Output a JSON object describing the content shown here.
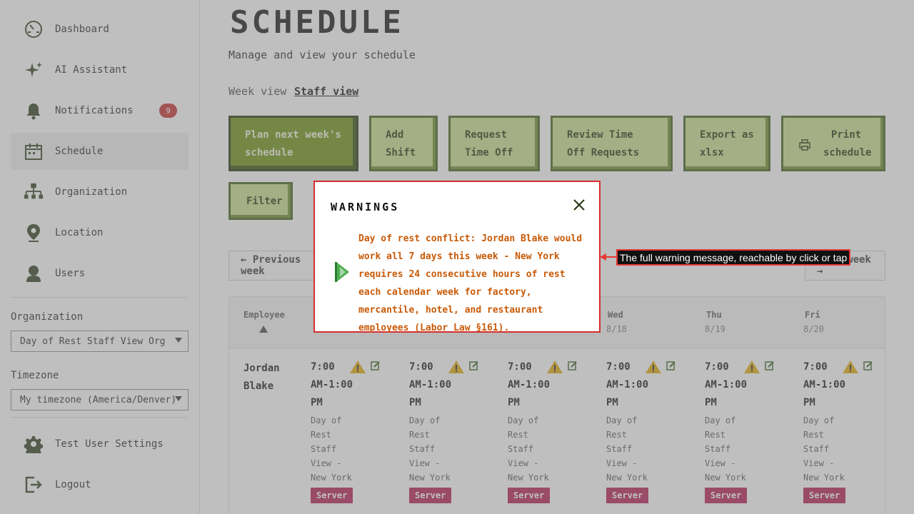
{
  "sidebar": {
    "items": [
      {
        "label": "Dashboard",
        "icon": "dashboard-icon"
      },
      {
        "label": "AI Assistant",
        "icon": "sparkle-icon"
      },
      {
        "label": "Notifications",
        "icon": "bell-icon",
        "badge": "9"
      },
      {
        "label": "Schedule",
        "icon": "calendar-icon",
        "active": true
      },
      {
        "label": "Organization",
        "icon": "org-chart-icon"
      },
      {
        "label": "Location",
        "icon": "location-pin-icon"
      },
      {
        "label": "Users",
        "icon": "user-icon"
      }
    ],
    "organization_label": "Organization",
    "organization_value": "Day of Rest Staff View Org",
    "timezone_label": "Timezone",
    "timezone_value": "My timezone (America/Denver)",
    "bottom_items": [
      {
        "label": "Test User Settings",
        "icon": "gear-icon"
      },
      {
        "label": "Logout",
        "icon": "logout-icon"
      }
    ]
  },
  "header": {
    "title": "SCHEDULE",
    "subtitle": "Manage and view your schedule"
  },
  "view_tabs": [
    {
      "label": "Week view",
      "active": false
    },
    {
      "label": "Staff view",
      "active": true
    }
  ],
  "actions": {
    "plan": "Plan next week's schedule",
    "add_shift": "Add Shift",
    "request_time_off": "Request Time Off",
    "review_time_off": "Review Time Off Requests",
    "export": "Export as xlsx",
    "print": "Print schedule",
    "filter": "Filter"
  },
  "week_nav": {
    "previous": "← Previous week",
    "next": "Next week →"
  },
  "table": {
    "employee_header": "Employee",
    "days": [
      {
        "name": "Wed",
        "date": "8/18"
      },
      {
        "name": "Thu",
        "date": "8/19"
      },
      {
        "name": "Fri",
        "date": "8/20"
      }
    ],
    "employee": "Jordan Blake",
    "shift_time": "7:00 AM-1:00 PM",
    "shift_location": "Day of Rest Staff View - New York",
    "role": "Server"
  },
  "modal": {
    "title": "WARNINGS",
    "message": "Day of rest conflict: Jordan Blake would work all 7 days this week - New York requires 24 consecutive hours of rest each calendar week for factory, mercantile, hotel, and restaurant employees (Labor Law §161)."
  },
  "tooltip": "The full warning message, reachable by click or tap",
  "colors": {
    "accent_green": "#c9df8a",
    "primary_green": "#6b8e0a",
    "warning_text": "#c85a08",
    "badge_red": "#c62828",
    "role_tag": "#b5174f",
    "modal_border": "#d32f2f"
  }
}
